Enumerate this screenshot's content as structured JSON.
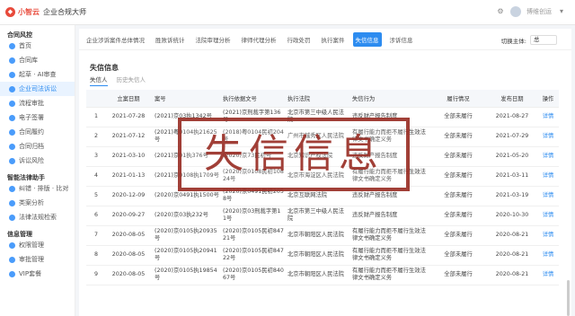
{
  "header": {
    "logo_text": "小智云",
    "app_title": "企业合规大师",
    "username": "博维创运"
  },
  "sidebar": {
    "sections": [
      {
        "title": "合同风控",
        "items": [
          "首页",
          "合同库",
          "起草 · AI审查",
          "企业司法诉讼",
          "流程审批",
          "电子签署",
          "合同履约",
          "合同归档",
          "诉讼风险"
        ]
      },
      {
        "title": "智能法律助手",
        "items": [
          "纠错 · 排版 · 比对",
          "类案分析",
          "法律法规检索"
        ]
      },
      {
        "title": "信息管理",
        "items": [
          "权限管理",
          "审批管理",
          "VIP套餐"
        ]
      }
    ],
    "active_item": "企业司法诉讼"
  },
  "tabs": [
    "企业涉诉案件总体情况",
    "胜败诉统计",
    "法院审理分析",
    "律师代理分析",
    "行政处罚",
    "执行案件",
    "失信信息",
    "涉诉信息"
  ],
  "active_tab": "失信信息",
  "subject": {
    "label": "切换主体:",
    "value": "总"
  },
  "section_title": "失信信息",
  "subtabs": [
    "失信人",
    "历史失信人"
  ],
  "table": {
    "headers": [
      "",
      "立案日期",
      "案号",
      "执行依据文号",
      "执行法院",
      "失信行为",
      "履行情况",
      "发布日期",
      "操作"
    ],
    "rows": [
      [
        "1",
        "2021-07-28",
        "(2021)京03执1342号",
        "(2021)京刑裁字第136号",
        "北京市第三中级人民法院",
        "违反财产报告制度",
        "全部未履行",
        "2021-08-27",
        "详情"
      ],
      [
        "2",
        "2021-07-12",
        "(2021)粤0104执21625号",
        "(2018)粤0104民初204号",
        "广州市越秀区人民法院",
        "有履行能力而拒不履行生效法律文书确定义务",
        "全部未履行",
        "2021-07-29",
        "详情"
      ],
      [
        "3",
        "2021-03-10",
        "(2021)京01执376号",
        "(2020)京73民初号",
        "北京知识产权法院",
        "违反财产报告制度",
        "全部未履行",
        "2021-05-20",
        "详情"
      ],
      [
        "4",
        "2021-01-13",
        "(2021)京0108执1709号",
        "(2020)京0108民初108 24号",
        "北京市海淀区人民法院",
        "有履行能力而拒不履行生效法律文书确定义务",
        "全部未履行",
        "2021-03-11",
        "详情"
      ],
      [
        "5",
        "2020-12-09",
        "(2020)京0491执1500号",
        "(2020)京0491民初205 8号",
        "北京互联网法院",
        "违反财产报告制度",
        "全部未履行",
        "2021-03-19",
        "详情"
      ],
      [
        "6",
        "2020-09-27",
        "(2020)京03执232号",
        "(2020)京03刑裁字第1 1号",
        "北京市第三中级人民法院",
        "违反财产报告制度",
        "全部未履行",
        "2020-10-30",
        "详情"
      ],
      [
        "7",
        "2020-08-05",
        "(2020)京0105执20935号",
        "(2020)京0105民初847 21号",
        "北京市朝阳区人民法院",
        "有履行能力而拒不履行生效法律文书确定义务",
        "全部未履行",
        "2020-08-21",
        "详情"
      ],
      [
        "8",
        "2020-08-05",
        "(2020)京0105执20941号",
        "(2020)京0105民初847 22号",
        "北京市朝阳区人民法院",
        "有履行能力而拒不履行生效法律文书确定义务",
        "全部未履行",
        "2020-08-21",
        "详情"
      ],
      [
        "9",
        "2020-08-05",
        "(2020)京0105执19854号",
        "(2020)京0105民初840 67号",
        "北京市朝阳区人民法院",
        "有履行能力而拒不履行生效法律文书确定义务",
        "全部未履行",
        "2020-08-21",
        "详情"
      ]
    ]
  },
  "watermark": "失信信息"
}
